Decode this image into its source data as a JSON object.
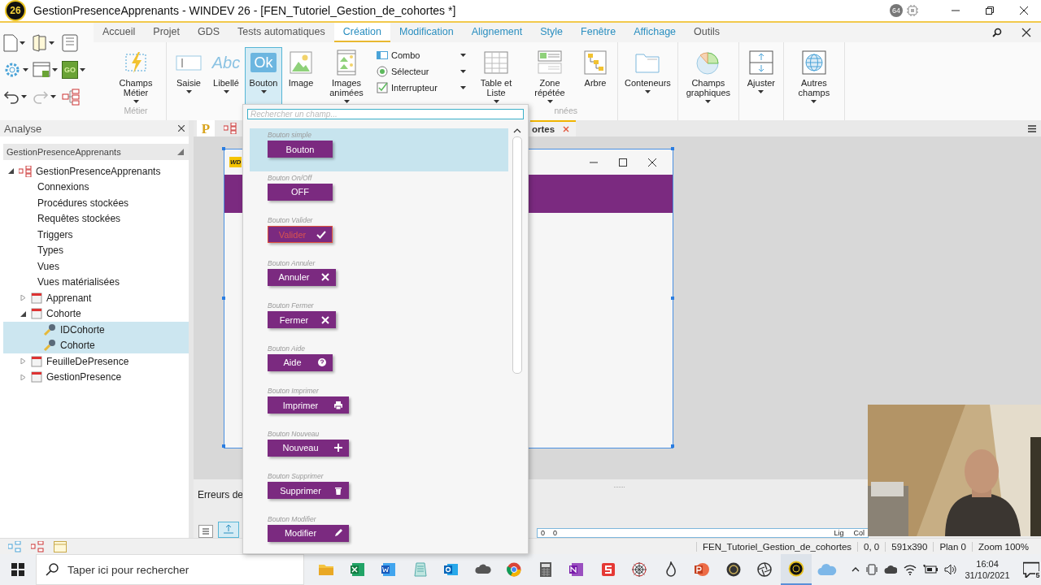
{
  "window": {
    "logo": "26",
    "title": "GestionPresenceApprenants - WINDEV 26 - [FEN_Tutoriel_Gestion_de_cohortes *]",
    "badge": "64"
  },
  "quick_access": {
    "go_label": "GO"
  },
  "ribbon_tabs": [
    {
      "label": "Accueil",
      "selected": false,
      "contextual": false
    },
    {
      "label": "Projet",
      "selected": false,
      "contextual": false
    },
    {
      "label": "GDS",
      "selected": false,
      "contextual": false
    },
    {
      "label": "Tests automatiques",
      "selected": false,
      "contextual": false
    },
    {
      "label": "Création",
      "selected": true,
      "contextual": true
    },
    {
      "label": "Modification",
      "selected": false,
      "contextual": true
    },
    {
      "label": "Alignement",
      "selected": false,
      "contextual": true
    },
    {
      "label": "Style",
      "selected": false,
      "contextual": true
    },
    {
      "label": "Fenêtre",
      "selected": false,
      "contextual": true
    },
    {
      "label": "Affichage",
      "selected": false,
      "contextual": true
    },
    {
      "label": "Outils",
      "selected": false,
      "contextual": false
    }
  ],
  "ribbon_groups": [
    {
      "label": "Métier",
      "items": [
        {
          "kind": "large",
          "label": "Champs Métier",
          "dropdown": true,
          "pressed": false
        }
      ]
    },
    {
      "label": "nnées",
      "items": [
        {
          "kind": "large",
          "label": "Saisie",
          "dropdown": true,
          "pressed": false
        },
        {
          "kind": "large",
          "label": "Libellé",
          "icon_text": "Abc",
          "dropdown": true,
          "pressed": false
        },
        {
          "kind": "large",
          "label": "Bouton",
          "icon_text": "Ok",
          "dropdown": true,
          "pressed": true
        },
        {
          "kind": "large",
          "label": "Image",
          "dropdown": false,
          "pressed": false
        },
        {
          "kind": "large",
          "label": "Images animées",
          "dropdown": true,
          "pressed": false
        },
        {
          "kind": "stack",
          "entries": [
            {
              "label": "Combo"
            },
            {
              "label": "Sélecteur"
            },
            {
              "label": "Interrupteur"
            }
          ]
        },
        {
          "kind": "large",
          "label": "Table et Liste",
          "dropdown": true,
          "pressed": false
        },
        {
          "kind": "large",
          "label": "Zone répétée",
          "dropdown": true,
          "pressed": false
        },
        {
          "kind": "large",
          "label": "Arbre",
          "dropdown": false,
          "pressed": false
        }
      ]
    },
    {
      "items": [
        {
          "kind": "large",
          "label": "Conteneurs",
          "dropdown": true,
          "pressed": false
        }
      ]
    },
    {
      "items": [
        {
          "kind": "large",
          "label": "Champs graphiques",
          "dropdown": true,
          "pressed": false
        }
      ]
    },
    {
      "items": [
        {
          "kind": "large",
          "label": "Ajuster",
          "dropdown": true,
          "pressed": false
        }
      ]
    },
    {
      "items": [
        {
          "kind": "large",
          "label": "Autres champs",
          "dropdown": true,
          "pressed": false
        }
      ]
    }
  ],
  "analysis": {
    "title": "Analyse",
    "header": "GestionPresenceApprenants",
    "tree": [
      {
        "kind": "root",
        "label": "GestionPresenceApprenants",
        "expanded": true,
        "selected": false,
        "children": [
          {
            "kind": "section",
            "label": "Connexions",
            "selected": false
          },
          {
            "kind": "section",
            "label": "Procédures stockées",
            "selected": false
          },
          {
            "kind": "section",
            "label": "Requêtes stockées",
            "selected": false
          },
          {
            "kind": "section",
            "label": "Triggers",
            "selected": false
          },
          {
            "kind": "section",
            "label": "Types",
            "selected": false
          },
          {
            "kind": "section",
            "label": "Vues",
            "selected": false
          },
          {
            "kind": "section",
            "label": "Vues matérialisées",
            "selected": false
          },
          {
            "kind": "table",
            "label": "Apprenant",
            "expanded": false,
            "selected": false
          },
          {
            "kind": "table",
            "label": "Cohorte",
            "expanded": true,
            "selected": false,
            "children": [
              {
                "kind": "field",
                "label": "IDCohorte",
                "selected": true
              },
              {
                "kind": "field",
                "label": "Cohorte",
                "selected": true
              }
            ]
          },
          {
            "kind": "table",
            "label": "FeuilleDePresence",
            "expanded": false,
            "selected": false
          },
          {
            "kind": "table",
            "label": "GestionPresence",
            "expanded": false,
            "selected": false
          }
        ]
      }
    ]
  },
  "editor": {
    "tabs": [
      {
        "kind": "project",
        "label": "P",
        "selected": false
      },
      {
        "kind": "window",
        "label": "ortes",
        "selected": true
      }
    ],
    "window_badge": "WD",
    "bottom_panel": {
      "title": "Erreurs de",
      "counts": [
        "0",
        "0"
      ],
      "columns": [
        "Lig",
        "Col"
      ]
    }
  },
  "picker": {
    "placeholder": "Rechercher un champ...",
    "items": [
      {
        "caption": "Bouton simple",
        "label": "Bouton",
        "kind": "plain",
        "selected": true,
        "outlined": false
      },
      {
        "caption": "Bouton On/Off",
        "label": "OFF",
        "kind": "plain",
        "selected": false,
        "outlined": false
      },
      {
        "caption": "Bouton Valider",
        "label": "Valider",
        "kind": "check",
        "selected": false,
        "outlined": true
      },
      {
        "caption": "Bouton Annuler",
        "label": "Annuler",
        "kind": "cross",
        "selected": false,
        "outlined": false
      },
      {
        "caption": "Bouton Fermer",
        "label": "Fermer",
        "kind": "cross",
        "selected": false,
        "outlined": false
      },
      {
        "caption": "Bouton Aide",
        "label": "Aide",
        "kind": "help",
        "selected": false,
        "outlined": false
      },
      {
        "caption": "Bouton Imprimer",
        "label": "Imprimer",
        "kind": "print",
        "selected": false,
        "outlined": false
      },
      {
        "caption": "Bouton Nouveau",
        "label": "Nouveau",
        "kind": "plus",
        "selected": false,
        "outlined": false
      },
      {
        "caption": "Bouton Supprimer",
        "label": "Supprimer",
        "kind": "trash",
        "selected": false,
        "outlined": false
      },
      {
        "caption": "Bouton Modifier",
        "label": "Modifier",
        "kind": "pencil",
        "selected": false,
        "outlined": false
      }
    ]
  },
  "status_bar": {
    "items": [
      "FEN_Tutoriel_Gestion_de_cohortes",
      "0, 0",
      "591x390",
      "Plan 0",
      "Zoom 100%"
    ]
  },
  "taskbar": {
    "search_placeholder": "Taper ici pour rechercher",
    "time": "16:04",
    "date": "31/10/2021",
    "notifications": "5"
  }
}
